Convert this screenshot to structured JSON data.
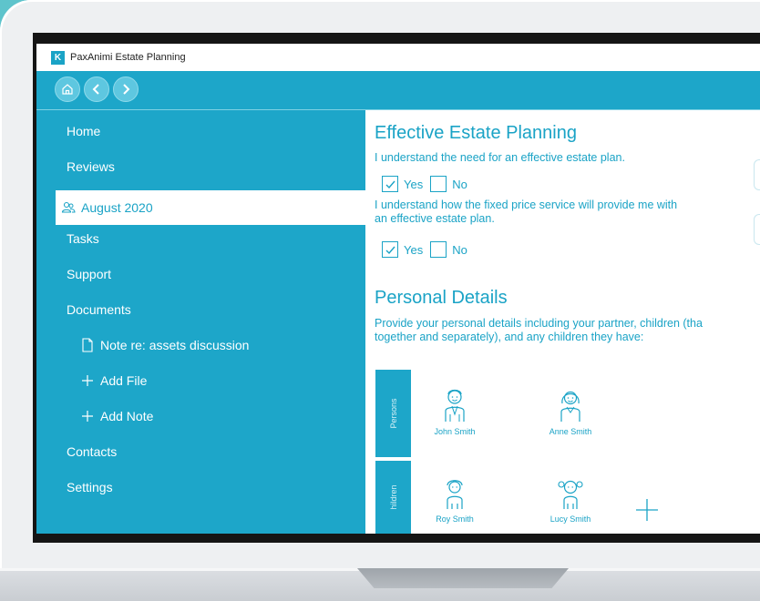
{
  "window": {
    "title": "PaxAnimi Estate Planning",
    "logo_text": "K"
  },
  "toolbar": {
    "home_icon": "home-icon",
    "back_icon": "chevron-left-icon",
    "forward_icon": "chevron-right-icon"
  },
  "sidebar": {
    "items": [
      {
        "label": "Home"
      },
      {
        "label": "Reviews"
      },
      {
        "label": "August 2020",
        "icon": "users-icon",
        "selected": true
      },
      {
        "label": "Tasks"
      },
      {
        "label": "Support"
      },
      {
        "label": "Documents"
      },
      {
        "label": "Note re: assets discussion",
        "icon": "document-icon"
      },
      {
        "label": "Add File",
        "icon": "plus-icon"
      },
      {
        "label": "Add Note",
        "icon": "plus-icon"
      },
      {
        "label": "Contacts"
      },
      {
        "label": "Settings"
      }
    ]
  },
  "content": {
    "section1_title": "Effective Estate Planning",
    "q1": {
      "text": "I understand the need for an effective estate plan.",
      "yes": "Yes",
      "no": "No",
      "yes_checked": true,
      "no_checked": false
    },
    "q2": {
      "line1": "I understand how the fixed price service will provide me with",
      "line2": "an effective estate plan.",
      "yes": "Yes",
      "no": "No",
      "yes_checked": true,
      "no_checked": false
    },
    "section2_title": "Personal Details",
    "details": {
      "line1": "Provide your personal details including your partner, children (tha",
      "line2": "together and separately), and any children they have:"
    },
    "groups": {
      "persons_label": "Persons",
      "children_label": "hildren",
      "persons": [
        {
          "name": "John Smith"
        },
        {
          "name": "Anne Smith"
        }
      ],
      "children": [
        {
          "name": "Roy Smith"
        },
        {
          "name": "Lucy Smith"
        }
      ]
    }
  },
  "colors": {
    "accent": "#1da6c9",
    "text_accent": "#1aa3c6",
    "background": "#5ec4cc"
  }
}
